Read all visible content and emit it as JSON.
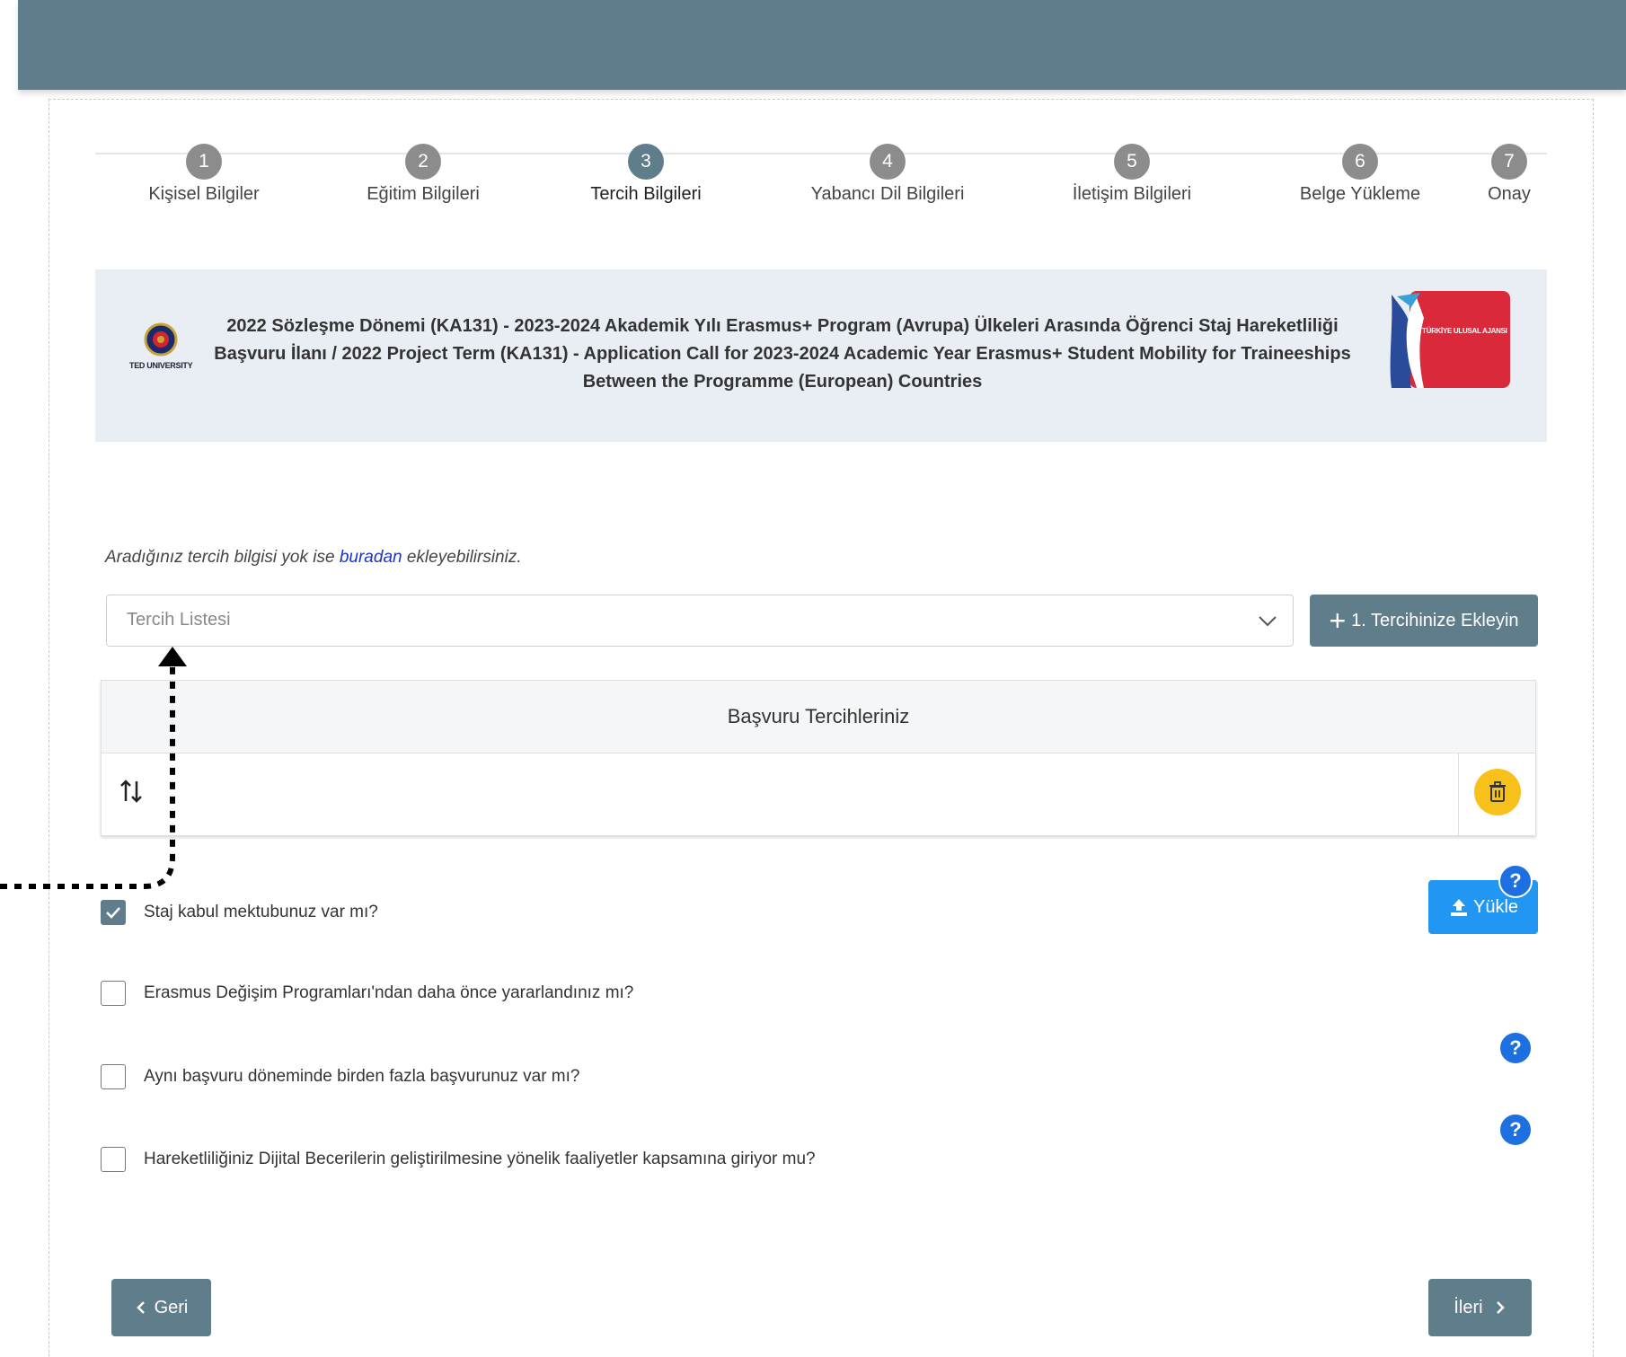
{
  "steps": [
    {
      "num": "1",
      "label": "Kişisel Bilgiler"
    },
    {
      "num": "2",
      "label": "Eğitim Bilgileri"
    },
    {
      "num": "3",
      "label": "Tercih Bilgileri"
    },
    {
      "num": "4",
      "label": "Yabancı Dil Bilgileri"
    },
    {
      "num": "5",
      "label": "İletişim Bilgileri"
    },
    {
      "num": "6",
      "label": "Belge Yükleme"
    },
    {
      "num": "7",
      "label": "Onay"
    }
  ],
  "active_step": "3",
  "banner": {
    "title": "2022 Sözleşme Dönemi (KA131) - 2023-2024 Akademik Yılı Erasmus+ Program (Avrupa) Ülkeleri Arasında Öğrenci Staj Hareketliliği Başvuru İlanı / 2022 Project Term (KA131) - Application Call for 2023-2024 Academic Year Erasmus+ Student Mobility for Traineeships Between the Programme (European) Countries",
    "left_logo_text": "TED UNIVERSITY",
    "right_logo_text": "TÜRKİYE ULUSAL AJANSI"
  },
  "hint": {
    "before": "Aradığınız tercih bilgisi yok ise ",
    "link": "buradan",
    "after": " ekleyebilirsiniz."
  },
  "select": {
    "placeholder": "Tercih Listesi"
  },
  "add_button": {
    "label": "1. Tercihinize Ekleyin"
  },
  "table": {
    "header": "Başvuru Tercihleriniz"
  },
  "checkboxes": [
    {
      "label": "Staj kabul mektubunuz var mı?",
      "checked": true
    },
    {
      "label": "Erasmus Değişim Programları'ndan daha önce yararlandınız mı?",
      "checked": false
    },
    {
      "label": "Aynı başvuru döneminde birden fazla başvurunuz var mı?",
      "checked": false
    },
    {
      "label": "Hareketliliğiniz Dijital Becerilerin geliştirilmesine yönelik faaliyetler kapsamına giriyor mu?",
      "checked": false
    }
  ],
  "upload_button": {
    "label": "Yükle"
  },
  "help_glyph": "?",
  "nav": {
    "back": "Geri",
    "next": "İleri"
  },
  "colors": {
    "primary": "#607d8b",
    "upload": "#2196f3",
    "help": "#1e6fe0",
    "delete": "#f8c01b",
    "banner_bg": "#e8eef3"
  }
}
